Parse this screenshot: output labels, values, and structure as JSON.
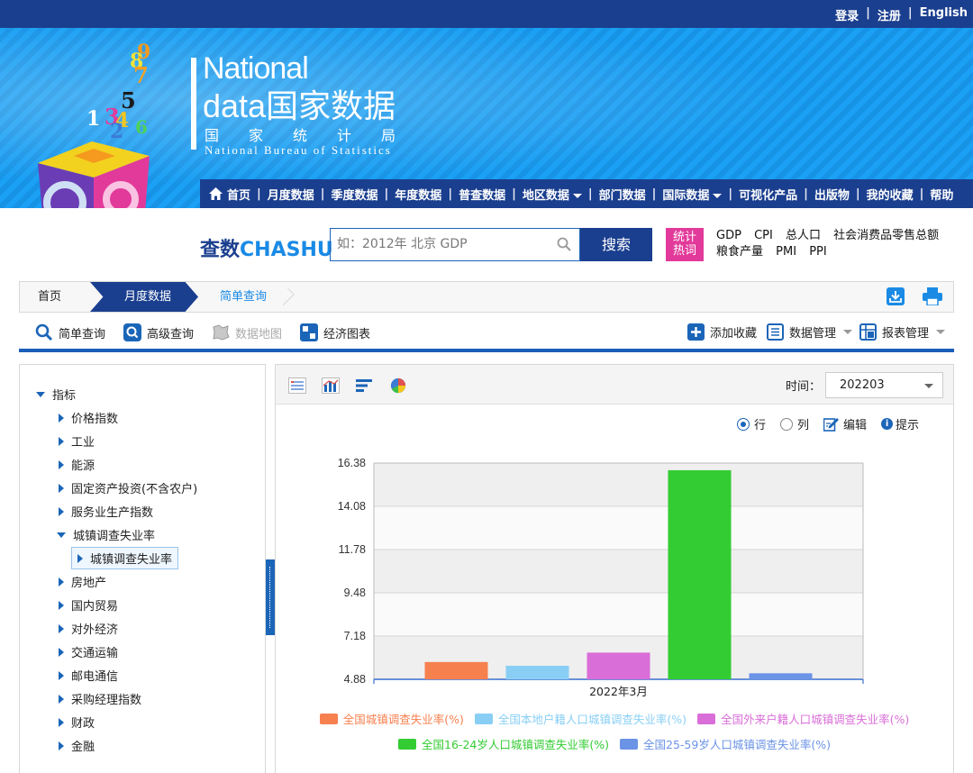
{
  "topbar": {
    "login": "登录",
    "register": "注册",
    "english": "English"
  },
  "brand": {
    "line1": "National",
    "line2": "data国家数据",
    "cn": "国家统计局",
    "en": "National Bureau of Statistics",
    "digits": [
      "8",
      "7",
      "5",
      "1",
      "3",
      "4",
      "6",
      "2",
      "9"
    ]
  },
  "nav": {
    "items": [
      "首页",
      "月度数据",
      "季度数据",
      "年度数据",
      "普查数据",
      "地区数据",
      "部门数据",
      "国际数据",
      "可视化产品",
      "出版物",
      "我的收藏",
      "帮助"
    ]
  },
  "search": {
    "brand_a": "查数",
    "brand_b": "CHASHU",
    "placeholder": "如：2012年 北京 GDP",
    "button": "搜索",
    "hot_badge_1": "统计",
    "hot_badge_2": "热词",
    "hot_words_row1": [
      "GDP",
      "CPI",
      "总人口",
      "社会消费品零售总额"
    ],
    "hot_words_row2": [
      "粮食产量",
      "PMI",
      "PPI"
    ]
  },
  "breadcrumb": {
    "home": "首页",
    "month": "月度数据",
    "current": "简单查询"
  },
  "toolbar": {
    "simple": "简单查询",
    "advanced": "高级查询",
    "map": "数据地图",
    "econ": "经济图表",
    "add_fav": "添加收藏",
    "data_mgmt": "数据管理",
    "report_mgmt": "报表管理"
  },
  "tree": {
    "root": "指标",
    "items": [
      "价格指数",
      "工业",
      "能源",
      "固定资产投资(不含农户)",
      "服务业生产指数",
      "城镇调查失业率",
      "房地产",
      "国内贸易",
      "对外经济",
      "交通运输",
      "邮电通信",
      "采购经理指数",
      "财政",
      "金融"
    ],
    "expanded_child": "城镇调查失业率"
  },
  "panel": {
    "time_label": "时间：",
    "time_value": "202203",
    "opt_row": "行",
    "opt_col": "列",
    "opt_edit": "编辑",
    "opt_tip": "提示"
  },
  "chart_data": {
    "type": "bar",
    "categories": [
      "2022年3月"
    ],
    "yticks": [
      "16.38",
      "14.08",
      "11.78",
      "9.48",
      "7.18",
      "4.88"
    ],
    "ylim": [
      4.88,
      16.38
    ],
    "series": [
      {
        "name": "全国城镇调查失业率(%)",
        "values": [
          5.8
        ],
        "color": "#f7804f"
      },
      {
        "name": "全国本地户籍人口城镇调查失业率(%)",
        "values": [
          5.6
        ],
        "color": "#89cff5"
      },
      {
        "name": "全国外来户籍人口城镇调查失业率(%)",
        "values": [
          6.3
        ],
        "color": "#d96ed8"
      },
      {
        "name": "全国16-24岁人口城镇调查失业率(%)",
        "values": [
          16.0
        ],
        "color": "#33cc33"
      },
      {
        "name": "全国25-59岁人口城镇调查失业率(%)",
        "values": [
          5.2
        ],
        "color": "#6b93e6"
      }
    ],
    "grid": true
  }
}
